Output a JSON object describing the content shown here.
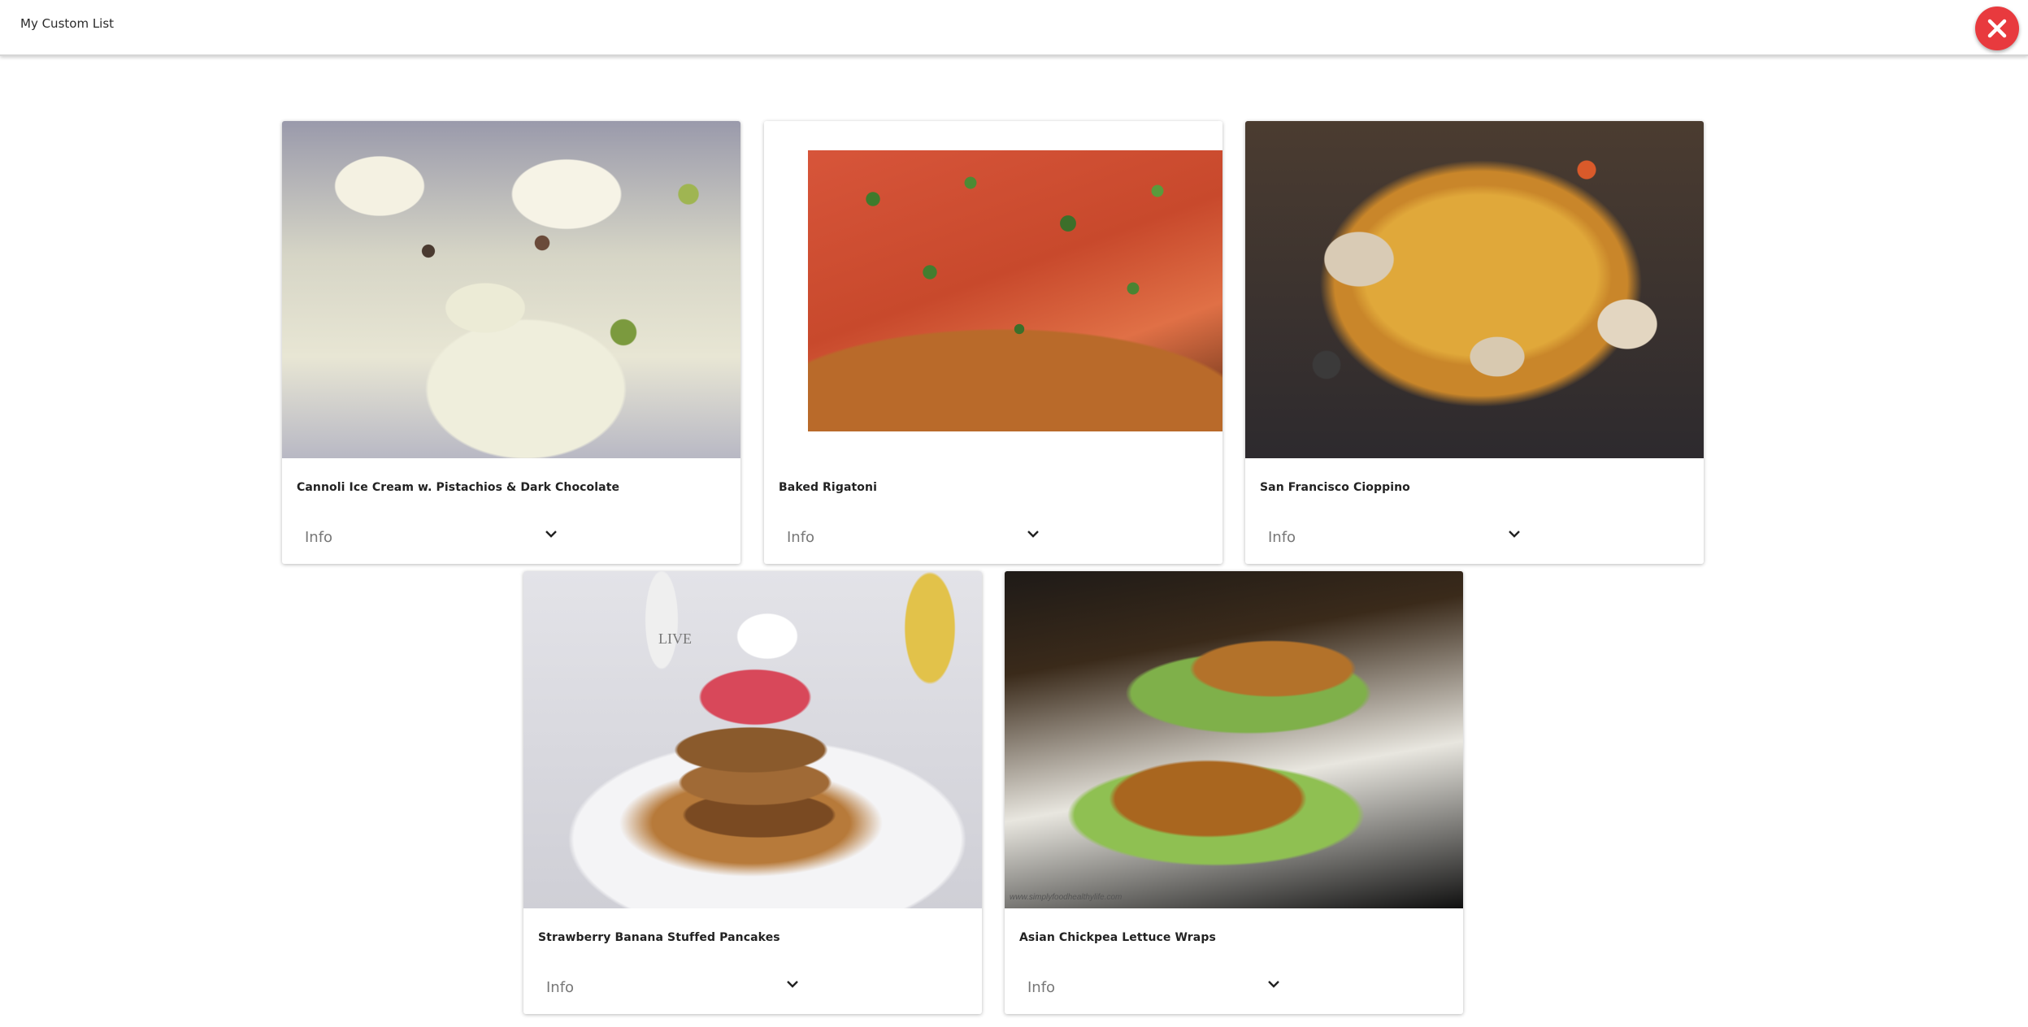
{
  "header": {
    "title": "My Custom List"
  },
  "close_icon": "close-icon",
  "colors": {
    "close_button": "#e83a3e"
  },
  "cards": [
    {
      "name": "Cannoli Ice Cream w. Pistachios & Dark Chocolate",
      "info": "Info"
    },
    {
      "name": "Baked Rigatoni",
      "info": "Info"
    },
    {
      "name": "San Francisco Cioppino",
      "info": "Info"
    },
    {
      "name": "Strawberry Banana Stuffed Pancakes",
      "info": "Info",
      "image_text": "LIVE"
    },
    {
      "name": "Asian Chickpea Lettuce Wraps",
      "info": "Info",
      "image_text": "www.simplyfoodhealthylife.com"
    }
  ]
}
